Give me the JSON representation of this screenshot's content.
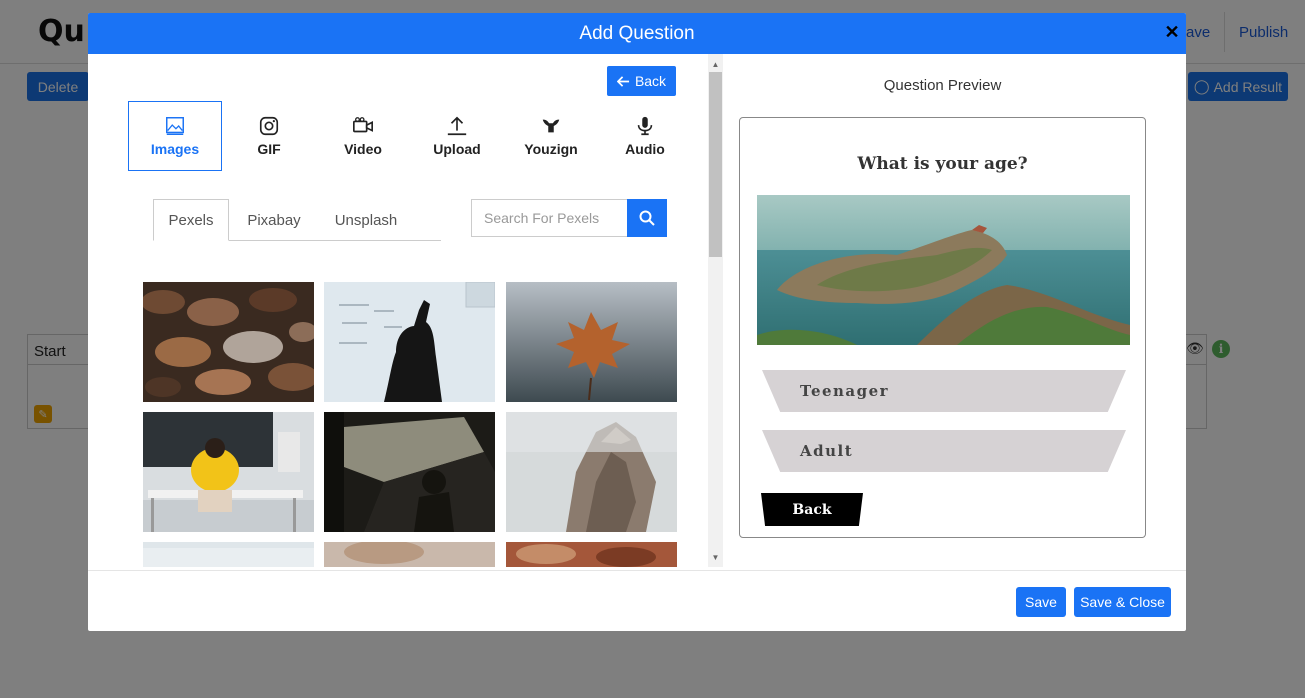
{
  "background": {
    "logo_text": "Qu",
    "save_label": "ave",
    "publish_label": "Publish",
    "delete_label": "Delete",
    "add_result_label": "Add Result",
    "start_label": "Start"
  },
  "modal": {
    "title": "Add Question",
    "close_icon": "close-icon",
    "back_label": "Back",
    "media_tabs": [
      {
        "label": "Images",
        "icon": "image-icon",
        "active": true
      },
      {
        "label": "GIF",
        "icon": "instagram-icon",
        "active": false
      },
      {
        "label": "Video",
        "icon": "video-camera-icon",
        "active": false
      },
      {
        "label": "Upload",
        "icon": "upload-icon",
        "active": false
      },
      {
        "label": "Youzign",
        "icon": "youzign-icon",
        "active": false
      },
      {
        "label": "Audio",
        "icon": "microphone-icon",
        "active": false
      }
    ],
    "source_tabs": [
      {
        "label": "Pexels",
        "active": true
      },
      {
        "label": "Pixabay",
        "active": false
      },
      {
        "label": "Unsplash",
        "active": false
      }
    ],
    "search": {
      "placeholder": "Search For Pexels",
      "value": ""
    },
    "preview": {
      "title": "Question Preview",
      "question": "What is your age?",
      "answers": [
        "Teenager",
        "Adult"
      ],
      "back_label": "Back"
    },
    "footer": {
      "save_label": "Save",
      "save_close_label": "Save & Close"
    }
  },
  "colors": {
    "accent": "#1a73f5",
    "answer_bg": "#d6d2d4",
    "overlay": "rgba(0,0,0,0.5)"
  }
}
